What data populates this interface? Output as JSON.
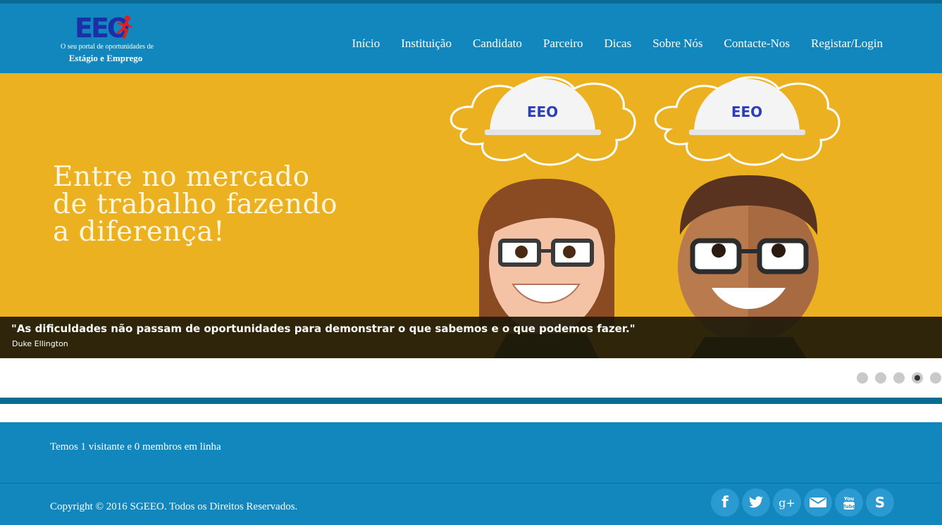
{
  "brand": {
    "mark": "EEO",
    "tagline": "O seu portal de oportunidades de",
    "subtitle": "Estágio e Emprego"
  },
  "nav": {
    "items": [
      {
        "label": "Início"
      },
      {
        "label": "Instituição"
      },
      {
        "label": "Candidato"
      },
      {
        "label": "Parceiro"
      },
      {
        "label": "Dicas"
      },
      {
        "label": "Sobre Nós"
      },
      {
        "label": "Contacte-Nos"
      },
      {
        "label": "Registar/Login"
      }
    ]
  },
  "hero": {
    "headline_lines": [
      "Entre no mercado",
      "de trabalho fazendo",
      "a diferença!"
    ],
    "helmet_text": "EEO",
    "caption_quote": "\"As dificuldades não passam de oportunidades para demonstrar o que sabemos e o que podemos fazer.\"",
    "caption_author": "Duke Ellington",
    "slide_count": 5,
    "active_slide": 4
  },
  "footer": {
    "visitors": "Temos 1 visitante e 0 membros em linha",
    "copyright": "Copyright © 2016 SGEEO. Todos os Direitos Reservados.",
    "social": [
      {
        "icon": "facebook-icon",
        "glyph": "f"
      },
      {
        "icon": "twitter-icon",
        "glyph": ""
      },
      {
        "icon": "google-plus-icon",
        "glyph": "g+"
      },
      {
        "icon": "email-icon",
        "glyph": ""
      },
      {
        "icon": "youtube-icon",
        "glyph": ""
      },
      {
        "icon": "skype-icon",
        "glyph": "S"
      }
    ]
  },
  "colors": {
    "header": "#1287be",
    "stripe": "#0b6a94",
    "hero": "#ebb120",
    "social_button": "#2a9ad0"
  }
}
